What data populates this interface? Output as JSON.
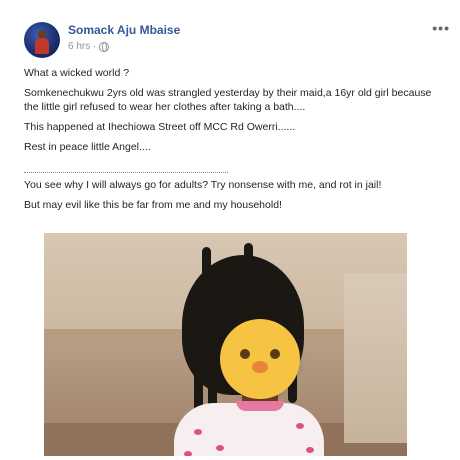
{
  "post": {
    "author": "Somack Aju Mbaise",
    "time": "6 hrs · ",
    "more": "•••",
    "paragraphs": [
      "What a wicked world ?",
      "Somkenechukwu 2yrs old was strangled yesterday by their maid,a 16yr old girl because the little girl refused to wear her clothes after taking a bath....",
      "This happened at Ihechiowa Street off MCC Rd Owerri......",
      "Rest in peace little Angel...."
    ],
    "paragraphs_after": [
      "You see why I will always go for adults? Try nonsense with me, and rot in jail!",
      "But may evil like this be far from me and my household!"
    ]
  },
  "icons": {
    "privacy": "globe-icon",
    "more": "ellipsis-icon",
    "censor": "chick-emoji-icon"
  },
  "colors": {
    "author_link": "#365899",
    "meta": "#90949c",
    "emoji_yellow": "#f6c343"
  }
}
